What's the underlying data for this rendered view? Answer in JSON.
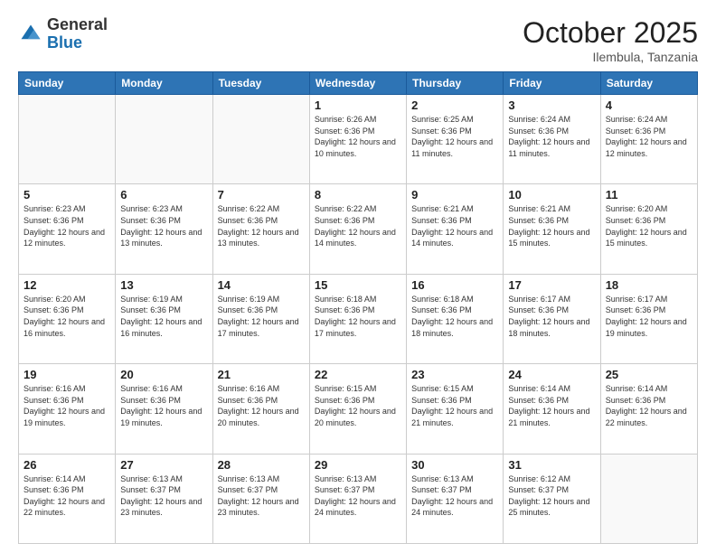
{
  "header": {
    "logo_general": "General",
    "logo_blue": "Blue",
    "month_title": "October 2025",
    "location": "Ilembula, Tanzania"
  },
  "days_of_week": [
    "Sunday",
    "Monday",
    "Tuesday",
    "Wednesday",
    "Thursday",
    "Friday",
    "Saturday"
  ],
  "weeks": [
    [
      {
        "day": "",
        "info": ""
      },
      {
        "day": "",
        "info": ""
      },
      {
        "day": "",
        "info": ""
      },
      {
        "day": "1",
        "info": "Sunrise: 6:26 AM\nSunset: 6:36 PM\nDaylight: 12 hours and 10 minutes."
      },
      {
        "day": "2",
        "info": "Sunrise: 6:25 AM\nSunset: 6:36 PM\nDaylight: 12 hours and 11 minutes."
      },
      {
        "day": "3",
        "info": "Sunrise: 6:24 AM\nSunset: 6:36 PM\nDaylight: 12 hours and 11 minutes."
      },
      {
        "day": "4",
        "info": "Sunrise: 6:24 AM\nSunset: 6:36 PM\nDaylight: 12 hours and 12 minutes."
      }
    ],
    [
      {
        "day": "5",
        "info": "Sunrise: 6:23 AM\nSunset: 6:36 PM\nDaylight: 12 hours and 12 minutes."
      },
      {
        "day": "6",
        "info": "Sunrise: 6:23 AM\nSunset: 6:36 PM\nDaylight: 12 hours and 13 minutes."
      },
      {
        "day": "7",
        "info": "Sunrise: 6:22 AM\nSunset: 6:36 PM\nDaylight: 12 hours and 13 minutes."
      },
      {
        "day": "8",
        "info": "Sunrise: 6:22 AM\nSunset: 6:36 PM\nDaylight: 12 hours and 14 minutes."
      },
      {
        "day": "9",
        "info": "Sunrise: 6:21 AM\nSunset: 6:36 PM\nDaylight: 12 hours and 14 minutes."
      },
      {
        "day": "10",
        "info": "Sunrise: 6:21 AM\nSunset: 6:36 PM\nDaylight: 12 hours and 15 minutes."
      },
      {
        "day": "11",
        "info": "Sunrise: 6:20 AM\nSunset: 6:36 PM\nDaylight: 12 hours and 15 minutes."
      }
    ],
    [
      {
        "day": "12",
        "info": "Sunrise: 6:20 AM\nSunset: 6:36 PM\nDaylight: 12 hours and 16 minutes."
      },
      {
        "day": "13",
        "info": "Sunrise: 6:19 AM\nSunset: 6:36 PM\nDaylight: 12 hours and 16 minutes."
      },
      {
        "day": "14",
        "info": "Sunrise: 6:19 AM\nSunset: 6:36 PM\nDaylight: 12 hours and 17 minutes."
      },
      {
        "day": "15",
        "info": "Sunrise: 6:18 AM\nSunset: 6:36 PM\nDaylight: 12 hours and 17 minutes."
      },
      {
        "day": "16",
        "info": "Sunrise: 6:18 AM\nSunset: 6:36 PM\nDaylight: 12 hours and 18 minutes."
      },
      {
        "day": "17",
        "info": "Sunrise: 6:17 AM\nSunset: 6:36 PM\nDaylight: 12 hours and 18 minutes."
      },
      {
        "day": "18",
        "info": "Sunrise: 6:17 AM\nSunset: 6:36 PM\nDaylight: 12 hours and 19 minutes."
      }
    ],
    [
      {
        "day": "19",
        "info": "Sunrise: 6:16 AM\nSunset: 6:36 PM\nDaylight: 12 hours and 19 minutes."
      },
      {
        "day": "20",
        "info": "Sunrise: 6:16 AM\nSunset: 6:36 PM\nDaylight: 12 hours and 19 minutes."
      },
      {
        "day": "21",
        "info": "Sunrise: 6:16 AM\nSunset: 6:36 PM\nDaylight: 12 hours and 20 minutes."
      },
      {
        "day": "22",
        "info": "Sunrise: 6:15 AM\nSunset: 6:36 PM\nDaylight: 12 hours and 20 minutes."
      },
      {
        "day": "23",
        "info": "Sunrise: 6:15 AM\nSunset: 6:36 PM\nDaylight: 12 hours and 21 minutes."
      },
      {
        "day": "24",
        "info": "Sunrise: 6:14 AM\nSunset: 6:36 PM\nDaylight: 12 hours and 21 minutes."
      },
      {
        "day": "25",
        "info": "Sunrise: 6:14 AM\nSunset: 6:36 PM\nDaylight: 12 hours and 22 minutes."
      }
    ],
    [
      {
        "day": "26",
        "info": "Sunrise: 6:14 AM\nSunset: 6:36 PM\nDaylight: 12 hours and 22 minutes."
      },
      {
        "day": "27",
        "info": "Sunrise: 6:13 AM\nSunset: 6:37 PM\nDaylight: 12 hours and 23 minutes."
      },
      {
        "day": "28",
        "info": "Sunrise: 6:13 AM\nSunset: 6:37 PM\nDaylight: 12 hours and 23 minutes."
      },
      {
        "day": "29",
        "info": "Sunrise: 6:13 AM\nSunset: 6:37 PM\nDaylight: 12 hours and 24 minutes."
      },
      {
        "day": "30",
        "info": "Sunrise: 6:13 AM\nSunset: 6:37 PM\nDaylight: 12 hours and 24 minutes."
      },
      {
        "day": "31",
        "info": "Sunrise: 6:12 AM\nSunset: 6:37 PM\nDaylight: 12 hours and 25 minutes."
      },
      {
        "day": "",
        "info": ""
      }
    ]
  ]
}
